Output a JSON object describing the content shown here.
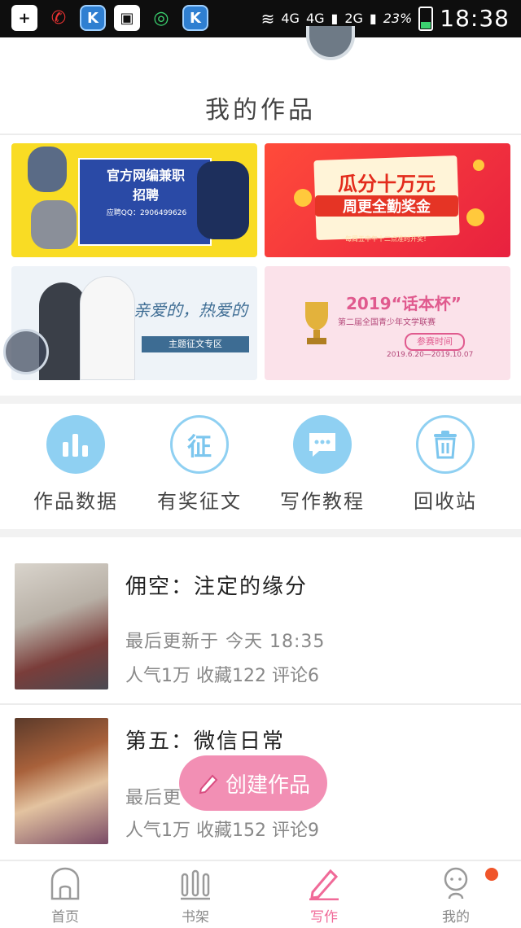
{
  "status_bar": {
    "network_1": "4G",
    "network_2": "4G",
    "network_3": "2G",
    "battery": "23%",
    "time": "18:38"
  },
  "header": {
    "title": "我的作品"
  },
  "banners": [
    {
      "title_line1": "官方网编兼职",
      "title_line2": "招聘",
      "subtitle": "应聘QQ：2906499626"
    },
    {
      "title_line1": "瓜分十万元",
      "title_line2": "周更全勤奖金",
      "subtitle": "每周五中午十二点准时开奖！"
    },
    {
      "title": "亲爱的，热爱的",
      "tag": "主题征文专区"
    },
    {
      "title": "2019“话本杯”",
      "subtitle": "第二届全国青少年文学联赛",
      "tag": "参赛时间",
      "dates": "2019.6.20—2019.10.07"
    }
  ],
  "tools": [
    {
      "label": "作品数据",
      "icon": "bar-chart-icon"
    },
    {
      "label": "有奖征文",
      "icon": "contest-icon"
    },
    {
      "label": "写作教程",
      "icon": "chat-bubble-icon"
    },
    {
      "label": "回收站",
      "icon": "trash-icon"
    }
  ],
  "works": [
    {
      "title": "佣空：注定的缘分",
      "updated": "最后更新于 今天 18:35",
      "stats": "人气1万 收藏122 评论6"
    },
    {
      "title": "第五：微信日常",
      "updated": "最后更",
      "stats": "人气1万 收藏152 评论9"
    }
  ],
  "create_button": {
    "label": "创建作品"
  },
  "tabbar": [
    {
      "label": "首页",
      "icon": "home-icon"
    },
    {
      "label": "书架",
      "icon": "bookshelf-icon"
    },
    {
      "label": "写作",
      "icon": "pen-icon",
      "active": true
    },
    {
      "label": "我的",
      "icon": "profile-icon"
    }
  ],
  "colors": {
    "accent_pink": "#f06a98",
    "tool_blue": "#8fd0f2",
    "button_pink": "#f28fb4",
    "notification_dot": "#f0552a"
  }
}
